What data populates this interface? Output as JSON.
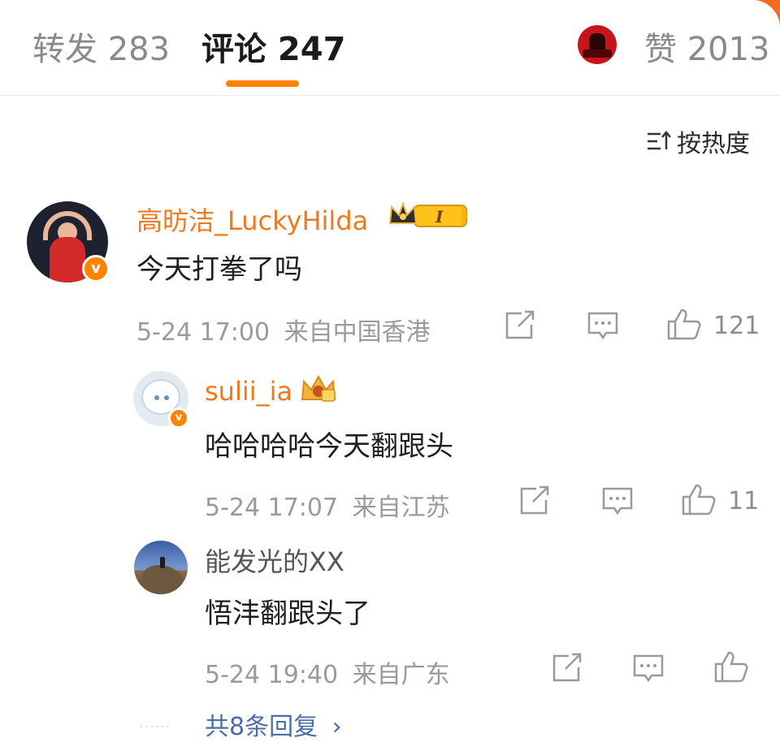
{
  "tabs": {
    "repost": "转发 283",
    "comments": "评论 247",
    "likes": "赞 2013"
  },
  "sort": {
    "label": "按热度",
    "icon": "sort-icon"
  },
  "colors": {
    "accent": "#ff8200",
    "name": "#ee7a1f",
    "link": "#4a6ea8"
  },
  "comment": {
    "username": "高昉洁_LuckyHilda",
    "badge_text": "I",
    "text": "今天打拳了吗",
    "time": "5-24 17:00",
    "location": "来自中国香港",
    "like_count": "121",
    "replies": [
      {
        "username": "sulii_ia",
        "text": "哈哈哈哈今天翻跟头",
        "time": "5-24 17:07",
        "location": "来自江苏",
        "like_count": "11"
      },
      {
        "username": "能发光的XX",
        "text": "悟沣翻跟头了",
        "time": "5-24 19:40",
        "location": "来自广东",
        "like_count": ""
      }
    ],
    "more_replies": "共8条回复"
  }
}
